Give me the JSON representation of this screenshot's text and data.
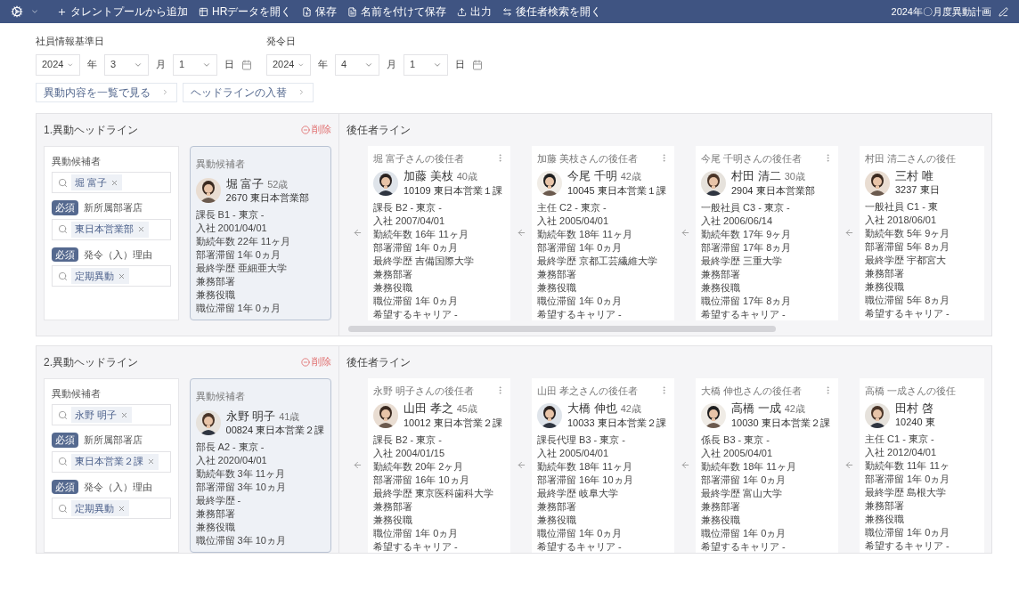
{
  "toolbar": {
    "items": [
      "タレントプールから追加",
      "HRデータを開く",
      "保存",
      "名前を付けて保存",
      "出力",
      "後任者検索を開く"
    ],
    "plan_title": "2024年〇月度異動計画"
  },
  "dates": [
    {
      "label": "社員情報基準日",
      "parts": [
        {
          "value": "2024",
          "unit": "年"
        },
        {
          "value": "3",
          "unit": "月"
        },
        {
          "value": "1",
          "unit": "日"
        }
      ]
    },
    {
      "label": "発令日",
      "parts": [
        {
          "value": "2024",
          "unit": "年"
        },
        {
          "value": "4",
          "unit": "月"
        },
        {
          "value": "1",
          "unit": "日"
        }
      ]
    }
  ],
  "actions": [
    "異動内容を一覧で見る",
    "ヘッドラインの入替"
  ],
  "headlines": [
    {
      "title": "1.異動ヘッドライン",
      "delete": "削除",
      "successor_title": "後任者ライン",
      "scrollbar_visible": true,
      "fields": [
        {
          "label": "異動候補者",
          "value": "堀 富子"
        },
        {
          "badge": "必須",
          "label": "新所属部署店",
          "value": "東日本営業部"
        },
        {
          "badge": "必須",
          "label": "発令（入）理由",
          "value": "定期異動"
        }
      ],
      "candidate": {
        "caption": "異動候補者",
        "name": "堀 富子",
        "age": "52歳",
        "dept": "2670 東日本営業部",
        "details": [
          "課長 B1 - 東京 -",
          "入社 2001/04/01",
          "勤続年数 22年 11ヶ月",
          "部署滞留 1年 0ヵ月",
          "最終学歴 亜細亜大学",
          "兼務部署",
          "兼務役職",
          "職位滞留 1年 0ヵ月"
        ]
      },
      "successors": [
        {
          "partial": false,
          "caption": "堀 富子さんの後任者",
          "name": "加藤 美枝",
          "age": "40歳",
          "dept": "10109 東日本営業１課",
          "details": [
            "課長 B2 - 東京 -",
            "入社 2007/04/01",
            "勤続年数 16年 11ヶ月",
            "部署滞留 1年 0ヵ月",
            "最終学歴 吉備国際大学",
            "兼務部署",
            "兼務役職",
            "職位滞留 1年 0ヵ月",
            "希望するキャリア -"
          ]
        },
        {
          "partial": false,
          "caption": "加藤 美枝さんの後任者",
          "name": "今尾 千明",
          "age": "42歳",
          "dept": "10045 東日本営業１課",
          "details": [
            "主任 C2 - 東京 -",
            "入社 2005/04/01",
            "勤続年数 18年 11ヶ月",
            "部署滞留 1年 0ヵ月",
            "最終学歴 京都工芸繊維大学",
            "兼務部署",
            "兼務役職",
            "職位滞留 1年 0ヵ月",
            "希望するキャリア -"
          ]
        },
        {
          "partial": false,
          "caption": "今尾 千明さんの後任者",
          "name": "村田 清二",
          "age": "30歳",
          "dept": "2904 東日本営業部",
          "details": [
            "一般社員 C3 - 東京 -",
            "入社 2006/06/14",
            "勤続年数 17年 9ヶ月",
            "部署滞留 17年 8ヵ月",
            "最終学歴 三重大学",
            "兼務部署",
            "兼務役職",
            "職位滞留 17年 8ヵ月",
            "希望するキャリア -"
          ]
        },
        {
          "partial": true,
          "caption": "村田 清二さんの後任",
          "name": "三村 唯",
          "dept": "3237 東日",
          "details": [
            "一般社員 C1 - 東",
            "入社 2018/06/01",
            "勤続年数 5年 9ヶ月",
            "部署滞留 5年 8ヵ月",
            "最終学歴 宇都宮大",
            "兼務部署",
            "兼務役職",
            "職位滞留 5年 8ヵ月",
            "希望するキャリア -"
          ]
        }
      ]
    },
    {
      "title": "2.異動ヘッドライン",
      "delete": "削除",
      "successor_title": "後任者ライン",
      "scrollbar_visible": false,
      "fields": [
        {
          "label": "異動候補者",
          "value": "永野 明子"
        },
        {
          "badge": "必須",
          "label": "新所属部署店",
          "value": "東日本営業２課"
        },
        {
          "badge": "必須",
          "label": "発令（入）理由",
          "value": "定期異動"
        }
      ],
      "candidate": {
        "caption": "異動候補者",
        "name": "永野 明子",
        "age": "41歳",
        "dept": "00824 東日本営業２課",
        "details": [
          "部長 A2 - 東京 -",
          "入社 2020/04/01",
          "勤続年数 3年 11ヶ月",
          "部署滞留 3年 10ヵ月",
          "最終学歴 -",
          "兼務部署",
          "兼務役職",
          "職位滞留 3年 10ヵ月"
        ]
      },
      "successors": [
        {
          "partial": false,
          "caption": "永野 明子さんの後任者",
          "name": "山田 孝之",
          "age": "45歳",
          "dept": "10012 東日本営業２課",
          "details": [
            "課長 B2 - 東京 -",
            "入社 2004/01/15",
            "勤続年数 20年 2ヶ月",
            "部署滞留 16年 10ヵ月",
            "最終学歴 東京医科歯科大学",
            "兼務部署",
            "兼務役職",
            "職位滞留 1年 0ヵ月",
            "希望するキャリア -"
          ]
        },
        {
          "partial": false,
          "caption": "山田 孝之さんの後任者",
          "name": "大橋 伸也",
          "age": "42歳",
          "dept": "10033 東日本営業２課",
          "details": [
            "課長代理 B3 - 東京 -",
            "入社 2005/04/01",
            "勤続年数 18年 11ヶ月",
            "部署滞留 16年 10ヵ月",
            "最終学歴 岐阜大学",
            "兼務部署",
            "兼務役職",
            "職位滞留 1年 0ヵ月",
            "希望するキャリア -"
          ]
        },
        {
          "partial": false,
          "caption": "大橋 伸也さんの後任者",
          "name": "高橋 一成",
          "age": "42歳",
          "dept": "10030 東日本営業２課",
          "details": [
            "係長 B3 - 東京 -",
            "入社 2005/04/01",
            "勤続年数 18年 11ヶ月",
            "部署滞留 1年 0ヵ月",
            "最終学歴 富山大学",
            "兼務部署",
            "兼務役職",
            "職位滞留 1年 0ヵ月",
            "希望するキャリア -"
          ]
        },
        {
          "partial": true,
          "caption": "高橋 一成さんの後任",
          "name": "田村 啓",
          "dept": "10240 東",
          "details": [
            "主任 C1 - 東京 -",
            "入社 2012/04/01",
            "勤続年数 11年 11ヶ",
            "部署滞留 1年 0ヵ月",
            "最終学歴 島根大学",
            "兼務部署",
            "兼務役職",
            "職位滞留 1年 0ヵ月",
            "希望するキャリア -"
          ]
        }
      ]
    }
  ]
}
